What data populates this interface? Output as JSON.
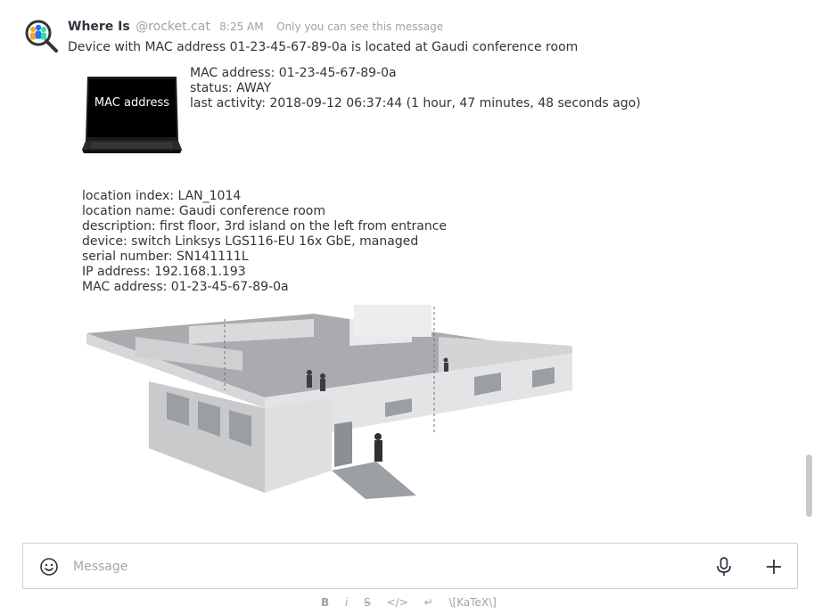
{
  "message": {
    "username": "Where Is",
    "handle": "@rocket.cat",
    "time": "8:25 AM",
    "visibility_note": "Only you can see this message",
    "text": "Device with MAC address 01-23-45-67-89-0a is located at Gaudi conference room",
    "device_image_label": "MAC address",
    "device_info": [
      "MAC address: 01-23-45-67-89-0a",
      "status: AWAY",
      "last activity: 2018-09-12 06:37:44 (1 hour, 47 minutes, 48 seconds ago)"
    ],
    "location_info": [
      "location index: LAN_1014",
      "location name: Gaudi conference room",
      "description: first floor, 3rd island on the left from entrance",
      "device: switch Linksys LGS116-EU 16x GbE, managed",
      "serial number: SN141111L",
      "IP address: 192.168.1.193",
      "MAC address: 01-23-45-67-89-0a"
    ]
  },
  "composer": {
    "placeholder": "Message",
    "emoji_icon": "smiley-icon",
    "mic_icon": "microphone-icon",
    "plus_icon": "plus-icon"
  },
  "format_toolbar": {
    "bold": "B",
    "italic": "i",
    "strike": "S",
    "code": "</>",
    "multiline": "↵",
    "katex": "\\[KaTeX\\]"
  }
}
